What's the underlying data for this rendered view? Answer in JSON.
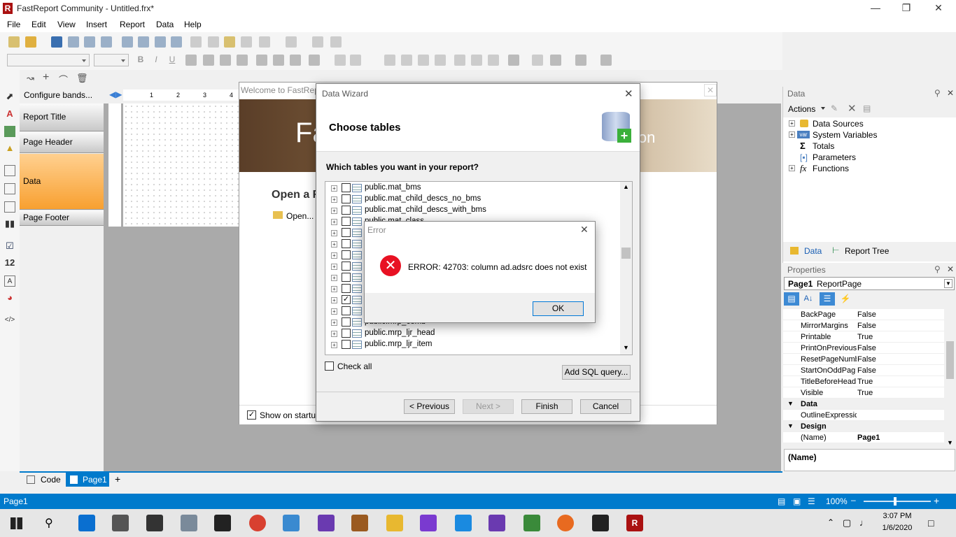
{
  "window": {
    "title": "FastReport Community - Untitled.frx*"
  },
  "menu": [
    "File",
    "Edit",
    "View",
    "Insert",
    "Report",
    "Data",
    "Help"
  ],
  "bands": {
    "configure": "Configure bands...",
    "items": [
      "Report Title",
      "Page Header",
      "Data",
      "Page Footer"
    ]
  },
  "ruler": [
    "1",
    "2",
    "3",
    "4"
  ],
  "welcome": {
    "title": "Welcome to FastRep",
    "banner_text": "Fa",
    "banner_text2": "ion",
    "open_heading": "Open a R",
    "open_link": "Open...",
    "show_startup": "Show on startup"
  },
  "wizard": {
    "title": "Data Wizard",
    "heading": "Choose tables",
    "question": "Which tables you want in your report?",
    "tables": [
      {
        "name": "public.mat_bms",
        "checked": false
      },
      {
        "name": "public.mat_child_descs_no_bms",
        "checked": false
      },
      {
        "name": "public.mat_child_descs_with_bms",
        "checked": false
      },
      {
        "name": "public.mat_class",
        "checked": false
      },
      {
        "name": "",
        "checked": false
      },
      {
        "name": "",
        "checked": false
      },
      {
        "name": "",
        "checked": false
      },
      {
        "name": "",
        "checked": false
      },
      {
        "name": "",
        "checked": false
      },
      {
        "name": "",
        "checked": false
      },
      {
        "name": "",
        "checked": true
      },
      {
        "name": "",
        "checked": false
      },
      {
        "name": "public.mrp_comb",
        "checked": false
      },
      {
        "name": "public.mrp_ljr_head",
        "checked": false
      },
      {
        "name": "public.mrp_ljr_item",
        "checked": false
      }
    ],
    "check_all": "Check all",
    "add_sql": "Add SQL query...",
    "prev": "< Previous",
    "next": "Next >",
    "finish": "Finish",
    "cancel": "Cancel"
  },
  "error": {
    "title": "Error",
    "message": "ERROR: 42703: column ad.adsrc does not exist",
    "ok": "OK"
  },
  "data_panel": {
    "title": "Data",
    "actions": "Actions",
    "tree": [
      "Data Sources",
      "System Variables",
      "Totals",
      "Parameters",
      "Functions"
    ],
    "tab_data": "Data",
    "tab_tree": "Report Tree"
  },
  "properties": {
    "title": "Properties",
    "object": "Page1",
    "object_type": "ReportPage",
    "rows": [
      {
        "k": "BackPage",
        "v": "False"
      },
      {
        "k": "MirrorMargins",
        "v": "False"
      },
      {
        "k": "Printable",
        "v": "True"
      },
      {
        "k": "PrintOnPrevious",
        "v": "False"
      },
      {
        "k": "ResetPageNumb",
        "v": "False"
      },
      {
        "k": "StartOnOddPag",
        "v": "False"
      },
      {
        "k": "TitleBeforeHead",
        "v": "True"
      },
      {
        "k": "Visible",
        "v": "True"
      }
    ],
    "cat_data": "Data",
    "outline": "OutlineExpressic",
    "cat_design": "Design",
    "name_k": "(Name)",
    "name_v": "Page1",
    "desc": "(Name)"
  },
  "tabs": {
    "code": "Code",
    "page": "Page1"
  },
  "status": {
    "left": "Page1",
    "zoom": "100%"
  },
  "clock": {
    "time": "3:07 PM",
    "date": "1/6/2020"
  }
}
